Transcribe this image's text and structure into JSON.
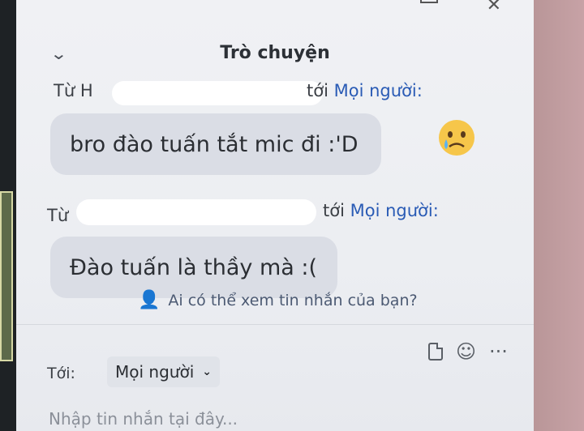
{
  "window": {
    "close_label": "✕"
  },
  "header": {
    "title": "Trò chuyện"
  },
  "messages": [
    {
      "prefix": "Từ H",
      "to_word": "tới",
      "recipient": "Mọi người:",
      "text": "bro đào tuấn tắt mic đi :'D",
      "reaction": "crying-face"
    },
    {
      "prefix": "Từ",
      "to_word": "tới",
      "recipient": "Mọi người:",
      "text": "Đào tuấn là thầy mà :("
    }
  ],
  "privacy": {
    "text": "Ai có thể xem tin nhắn của bạn?"
  },
  "composer": {
    "to_label": "Tới:",
    "recipient": "Mọi người",
    "placeholder": "Nhập tin nhắn tại đây...",
    "more_label": "···"
  },
  "colors": {
    "accent": "#2a5bb5",
    "bubble": "#dadde5"
  }
}
